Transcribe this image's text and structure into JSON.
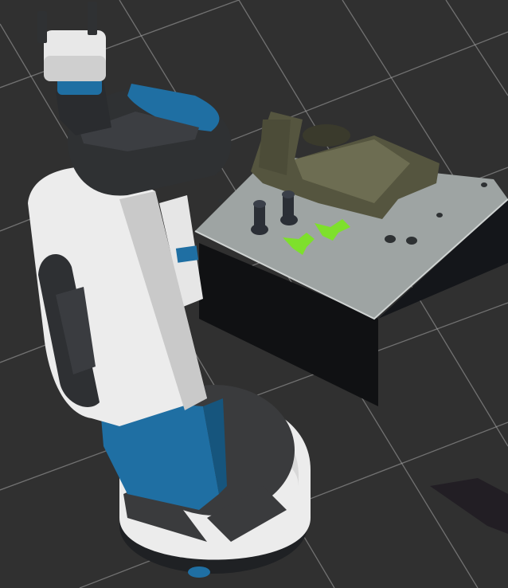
{
  "app": {
    "title": ""
  },
  "viewport": {
    "background": "#303030",
    "grid_color": "#a8a8a8",
    "robot": {
      "name_label": "",
      "colors": {
        "shell": "#ececec",
        "accent": "#1f6fa3",
        "dark": "#2f3133",
        "base_rim": "#f2f2f2"
      }
    },
    "table": {
      "top_color": "#9ea4a3",
      "side_color": "#101113"
    },
    "objects": {
      "bolts": {
        "count": 2,
        "color": "#2b2f36"
      },
      "gripper_markers": {
        "count": 2,
        "color": "#7ee02c"
      },
      "tray": {
        "color": "#5a5a44"
      }
    }
  }
}
